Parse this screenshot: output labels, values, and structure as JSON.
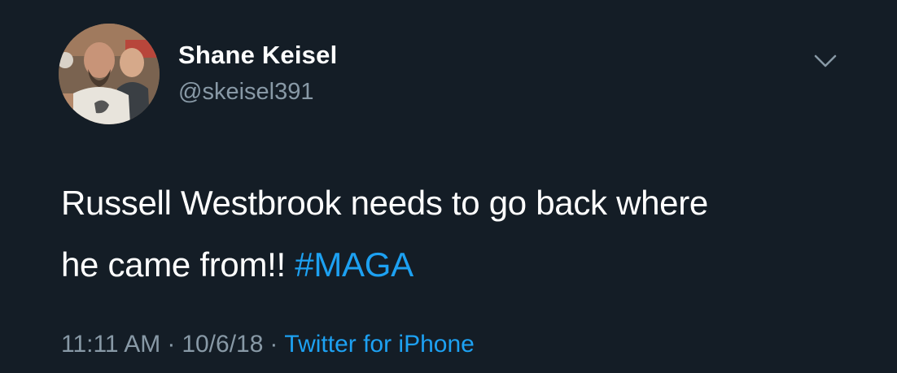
{
  "tweet": {
    "author": {
      "display_name": "Shane Keisel",
      "handle": "@skeisel391",
      "avatar_icon": "profile-photo"
    },
    "menu_icon": "chevron-down-icon",
    "text": {
      "line1": "Russell Westbrook needs to go back where",
      "line2": "he came from!! ",
      "hashtag": "#MAGA"
    },
    "meta": {
      "time": "11:11 AM",
      "separator1": "·",
      "date": "10/6/18",
      "separator2": "·",
      "source": "Twitter for iPhone"
    }
  },
  "colors": {
    "background": "#141d26",
    "text": "#ffffff",
    "secondary": "#8899a6",
    "link": "#1da1f2"
  }
}
